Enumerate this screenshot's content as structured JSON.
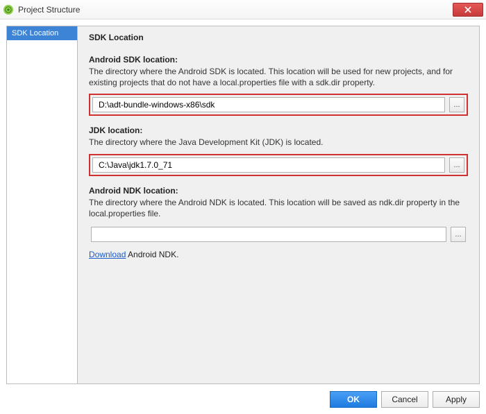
{
  "window": {
    "title": "Project Structure"
  },
  "sidebar": {
    "items": [
      "SDK Location"
    ]
  },
  "page": {
    "title": "SDK Location"
  },
  "sections": {
    "sdk": {
      "heading": "Android SDK location:",
      "desc": "The directory where the Android SDK is located. This location will be used for new projects, and for existing projects that do not have a local.properties file with a sdk.dir property.",
      "value": "D:\\adt-bundle-windows-x86\\sdk",
      "browse": "..."
    },
    "jdk": {
      "heading": "JDK location:",
      "desc": "The directory where the Java Development Kit (JDK) is located.",
      "value": "C:\\Java\\jdk1.7.0_71",
      "browse": "..."
    },
    "ndk": {
      "heading": "Android NDK location:",
      "desc": "The directory where the Android NDK is located. This location will be saved as ndk.dir property in the local.properties file.",
      "value": "",
      "browse": "...",
      "download_link": "Download",
      "download_tail": " Android NDK."
    }
  },
  "buttons": {
    "ok": "OK",
    "cancel": "Cancel",
    "apply": "Apply"
  }
}
